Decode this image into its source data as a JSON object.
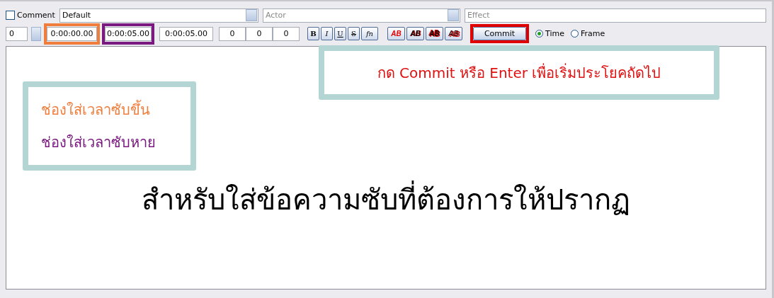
{
  "style_row": {
    "comment": {
      "label": "Comment",
      "checked": false
    },
    "style": {
      "value": "Default"
    },
    "actor": {
      "placeholder": "Actor"
    },
    "effect": {
      "placeholder": "Effect"
    }
  },
  "time_row": {
    "layer": "0",
    "times": [
      {
        "value": "0:00:00.00",
        "color": "#f07d3c"
      },
      {
        "value": "0:00:05.00",
        "color": "#7a1a80"
      },
      {
        "value": "0:00:05.00"
      }
    ],
    "margins": [
      "0",
      "0",
      "0"
    ],
    "format_buttons": [
      {
        "label": "B",
        "kind": "bold"
      },
      {
        "label": "I",
        "kind": "italic"
      },
      {
        "label": "U",
        "kind": "underline"
      },
      {
        "label": "S",
        "kind": "strike"
      },
      {
        "label": "fn",
        "kind": "font"
      }
    ],
    "color_buttons": [
      {
        "label": "AB",
        "kind": "primary"
      },
      {
        "label": "AB",
        "kind": "secondary"
      },
      {
        "label": "AB",
        "kind": "outline"
      },
      {
        "label": "AB",
        "kind": "shadow"
      }
    ],
    "commit": {
      "label": "Commit",
      "color": "#e00000"
    },
    "modes": [
      {
        "label": "Time",
        "selected": true
      },
      {
        "label": "Frame",
        "selected": false
      }
    ]
  },
  "editor": {
    "text": "สำหรับใส่ข้อความซับที่ต้องการให้ปรากฏ"
  },
  "callouts": [
    {
      "lines": [
        {
          "text": "ช่องใส่เวลาซับขึ้น",
          "color": "#f07d3c"
        },
        {
          "text": "ช่องใส่เวลาซับหาย",
          "color": "#7a1a80"
        }
      ]
    },
    {
      "lines": [
        {
          "text": "กด Commit หรือ Enter เพื่อเริ่มประโยคถัดไป",
          "color": "#e01010"
        }
      ]
    }
  ]
}
